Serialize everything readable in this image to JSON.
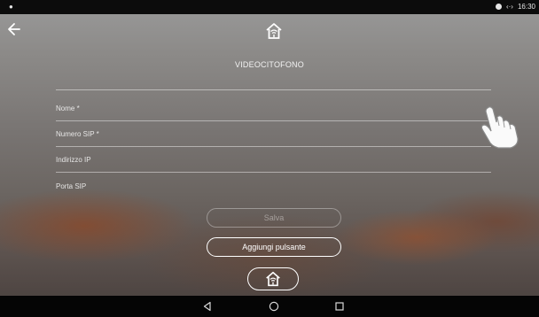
{
  "status_bar": {
    "time": "16:30"
  },
  "header": {
    "title": "VIDEOCITOFONO"
  },
  "form": {
    "fields": [
      {
        "label": "Nome *"
      },
      {
        "label": "Numero SIP *"
      },
      {
        "label": "Indirizzo IP"
      },
      {
        "label": "Porta SIP"
      }
    ]
  },
  "buttons": {
    "save_label": "Salva",
    "add_button_label": "Aggiungi pulsante"
  },
  "icons": {
    "back": "arrow-left-icon",
    "home_top": "home-wifi-icon",
    "home_bottom": "home-wifi-icon",
    "pointer": "hand-pointer-icon",
    "nav": [
      "nav-back-icon",
      "nav-home-icon",
      "nav-recents-icon"
    ]
  }
}
